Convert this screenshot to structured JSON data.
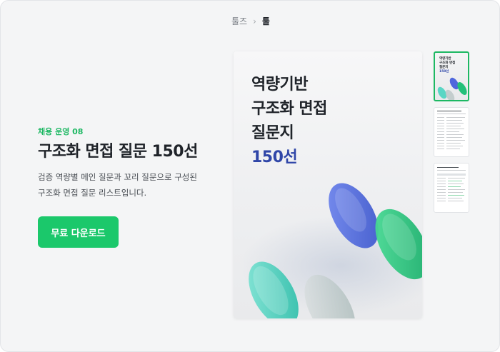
{
  "breadcrumb": {
    "parent": "툴즈",
    "separator": "›",
    "current": "툴"
  },
  "hero": {
    "label": "채용 운영 08",
    "title": "구조화 면접 질문 150선",
    "description_lines": [
      "검증 역량별 메인 질문과 꼬리 질문으로 구성된",
      "구조화 면접 질문 리스트입니다."
    ],
    "download_label": "무료 다운로드"
  },
  "cover": {
    "title_lines": [
      "역량기반",
      "구조화 면접",
      "질문지"
    ],
    "accent_line": "150선"
  },
  "thumbnails": {
    "cover_title_lines": [
      "역량기반",
      "구조화 면접",
      "질문지"
    ],
    "cover_accent_line": "150선",
    "selected_index": 0,
    "pages": [
      "cover",
      "page-2",
      "page-3"
    ]
  },
  "colors": {
    "brand_green": "#1db863",
    "button_green": "#1bc86b",
    "accent_blue": "#2f46a8",
    "background": "#f4f5f6"
  }
}
